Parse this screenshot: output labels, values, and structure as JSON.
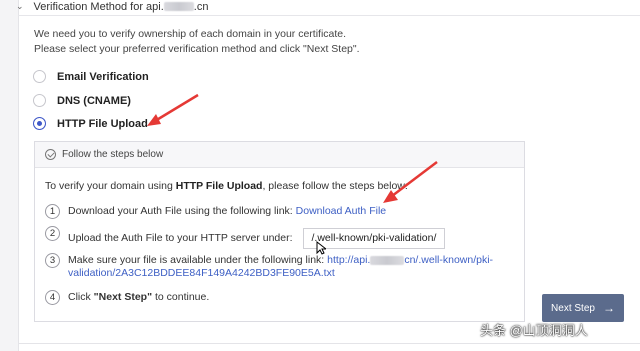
{
  "section": {
    "title_prefix": "Verification Method for api.",
    "title_suffix": ".cn"
  },
  "intro": {
    "line1": "We need you to verify ownership of each domain in your certificate.",
    "line2": "Please select your preferred verification method and click \"Next Step\"."
  },
  "methods": [
    {
      "label": "Email Verification",
      "selected": false
    },
    {
      "label": "DNS (CNAME)",
      "selected": false
    },
    {
      "label": "HTTP File Upload",
      "selected": true
    }
  ],
  "steps_box": {
    "header": "Follow the steps below",
    "desc_prefix": "To verify your domain using ",
    "desc_bold": "HTTP File Upload",
    "desc_suffix": ", please follow the steps below:",
    "steps": [
      {
        "num": "1",
        "text": "Download your Auth File using the following link: ",
        "link": "Download Auth File"
      },
      {
        "num": "2",
        "text": "Upload the Auth File to your HTTP server under:",
        "code": "/.well-known/pki-validation/"
      },
      {
        "num": "3",
        "text": "Make sure your file is available under the following link: ",
        "link_a": "http://api.",
        "link_b": "cn/.well-known/pki-",
        "link_c": "validation/2A3C12BDDEE84F149A4242BD3FE90E5A.txt"
      },
      {
        "num": "4",
        "text_a": "Click ",
        "text_bold": "\"Next Step\"",
        "text_b": " to continue."
      }
    ]
  },
  "next_button": {
    "label": "Next Step"
  },
  "watermark": "头条 @山顶洞洞人",
  "colors": {
    "accent": "#3f58c8",
    "link": "#3d5fc4",
    "button": "#5b6b8c",
    "annotation": "#e53935"
  }
}
